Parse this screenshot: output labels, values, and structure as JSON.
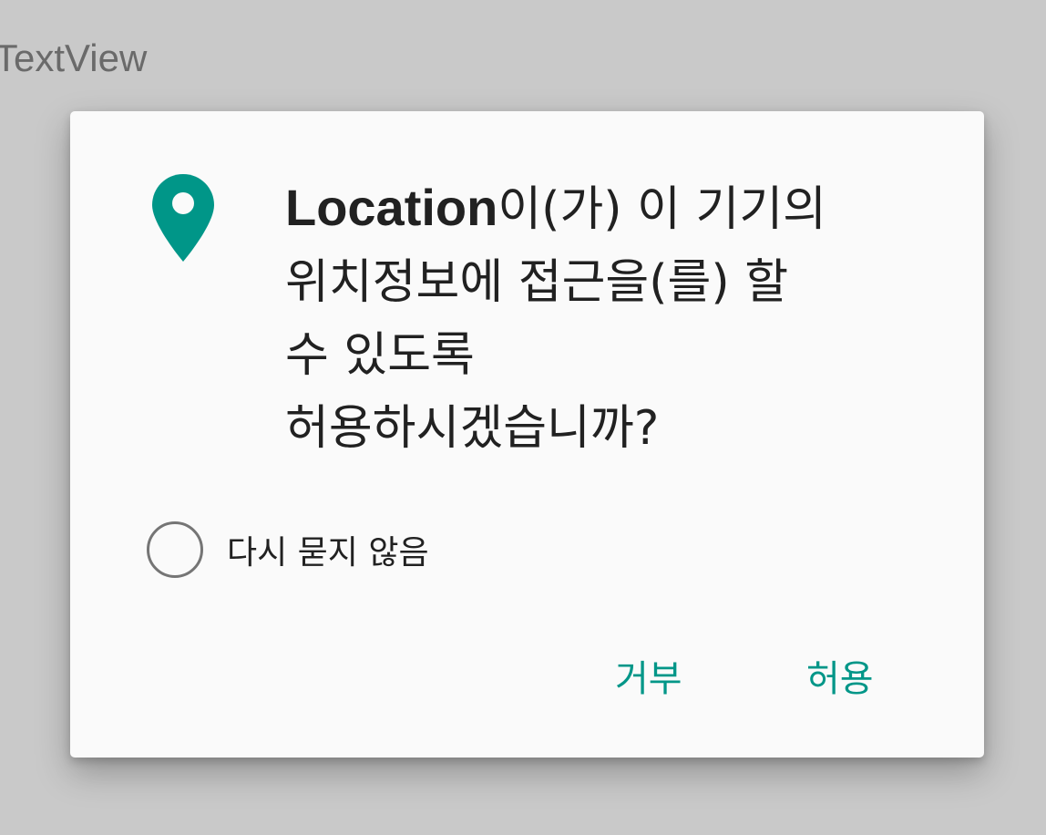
{
  "background": {
    "textview_label": "TextView"
  },
  "dialog": {
    "icon": "location-pin-icon",
    "accent_color": "#009688",
    "message": {
      "app_name": "Location",
      "line1_rest": "이(가) 이 기기의",
      "line2": "위치정보에 접근을(를) 할",
      "line3": "수 있도록",
      "line4": "허용하시겠습니까?"
    },
    "dont_ask_again": {
      "label": "다시 묻지 않음",
      "checked": false
    },
    "buttons": {
      "deny": "거부",
      "allow": "허용"
    }
  }
}
